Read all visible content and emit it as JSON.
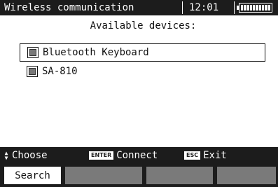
{
  "header": {
    "title": "Wireless communication",
    "clock": "12:01",
    "battery_level": 1.0
  },
  "heading": "Available devices:",
  "devices": [
    {
      "label": "Bluetooth Keyboard",
      "selected": true
    },
    {
      "label": "SA-810",
      "selected": false
    }
  ],
  "helpbar": {
    "choose_label": "Choose",
    "enter_key": "ENTER",
    "connect_label": "Connect",
    "esc_key": "ESC",
    "exit_label": "Exit"
  },
  "fkeys": {
    "f1_label": "Search",
    "f2_label": "",
    "f3_label": "",
    "f4_label": ""
  }
}
